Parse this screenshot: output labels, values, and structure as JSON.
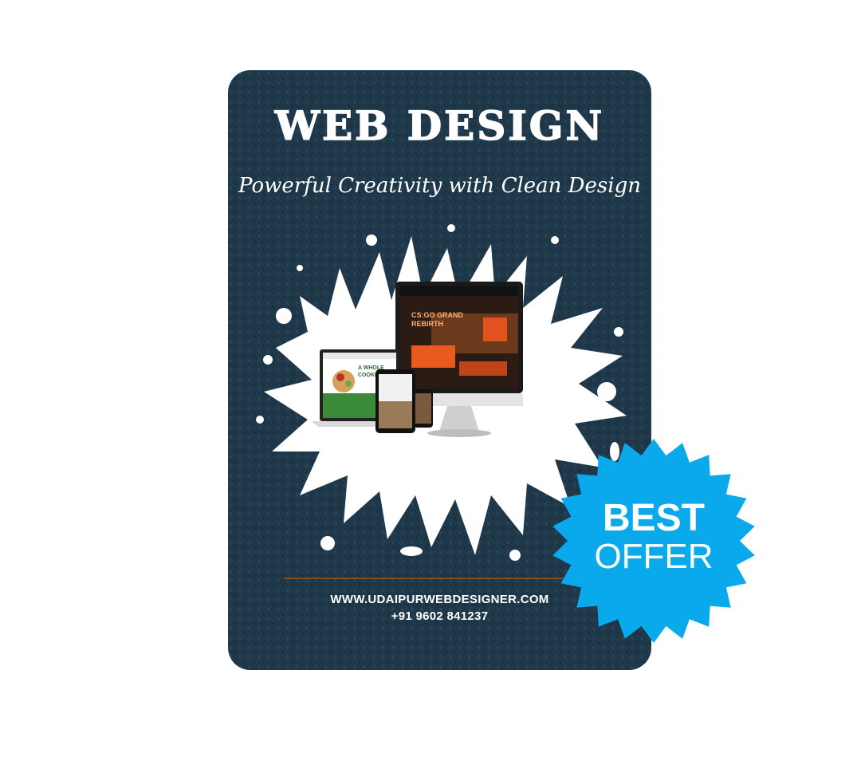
{
  "poster": {
    "title": "WEB DESIGN",
    "subtitle": "Powerful Creativity with Clean Design",
    "background_color": "#1f3a4d",
    "divider_color": "#8a4a1e",
    "website": "WWW.UDAIPURWEBDESIGNER.COM",
    "phone": "+91 9602 841237",
    "image": "devices-mockup-on-white-paint-splash",
    "screen_texts": {
      "monitor_headline_1": "CS:GO GRAND",
      "monitor_headline_2": "REBIRTH",
      "laptop_headline": "A WHOLE",
      "laptop_headline_2": "COOKING"
    }
  },
  "badge": {
    "line1": "BEST",
    "line2": "OFFER",
    "color": "#0aa9ec"
  }
}
